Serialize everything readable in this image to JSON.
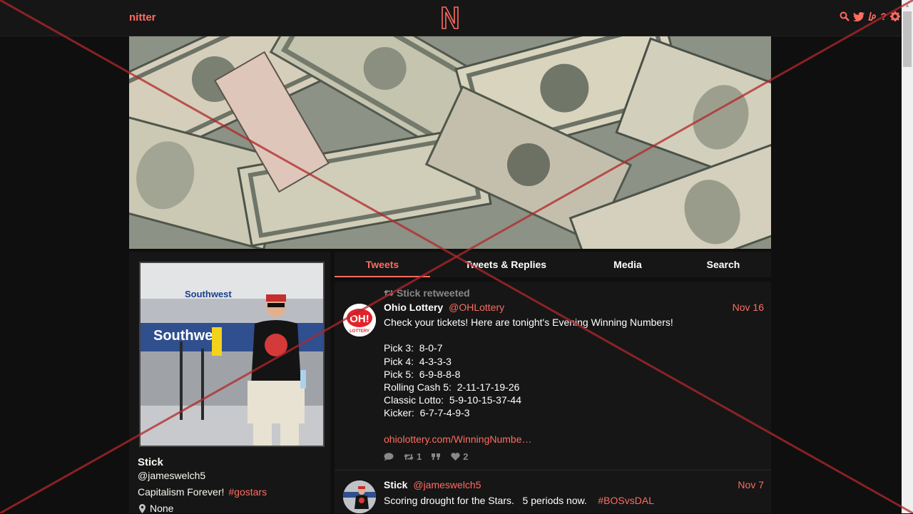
{
  "nav": {
    "logo_text": "nitter",
    "logo_letter": "N",
    "icons": [
      "search-icon",
      "twitter-icon",
      "liberapay-icon",
      "help-icon",
      "settings-icon"
    ],
    "help_glyph": "?"
  },
  "profile": {
    "fullname": "Stick",
    "username": "@jameswelch5",
    "bio_text": "Capitalism Forever!",
    "bio_hashtag": "#gostars",
    "location": "None",
    "avatar_sign_1": "Southwest",
    "avatar_sign_2": "Southwe"
  },
  "tabs": [
    {
      "label": "Tweets",
      "active": true
    },
    {
      "label": "Tweets & Replies",
      "active": false
    },
    {
      "label": "Media",
      "active": false
    },
    {
      "label": "Search",
      "active": false
    }
  ],
  "tweets": [
    {
      "retweet_header": "Stick retweeted",
      "fullname": "Ohio Lottery",
      "username": "@OHLottery",
      "date": "Nov 16",
      "avatar_text": "OH!",
      "avatar_subtext": "LOTTERY",
      "body": "Check your tickets! Here are tonight's Evening Winning Numbers!\n\nPick 3:  8-0-7\nPick 4:  4-3-3-3\nPick 5:  6-9-8-8-8\nRolling Cash 5:  2-11-17-19-26\nClassic Lotto:  5-9-10-15-37-44\nKicker:  6-7-7-4-9-3",
      "link": "ohiolottery.com/WinningNumbe…",
      "retweets": "1",
      "likes": "2"
    },
    {
      "fullname": "Stick",
      "username": "@jameswelch5",
      "date": "Nov 7",
      "body": "Scoring drought for the Stars.   5 periods now.",
      "hashtag": "#BOSvsDAL"
    }
  ],
  "colors": {
    "accent": "#ff6c60",
    "background": "#0f0f0f",
    "panel": "#161616",
    "muted": "#888889"
  }
}
